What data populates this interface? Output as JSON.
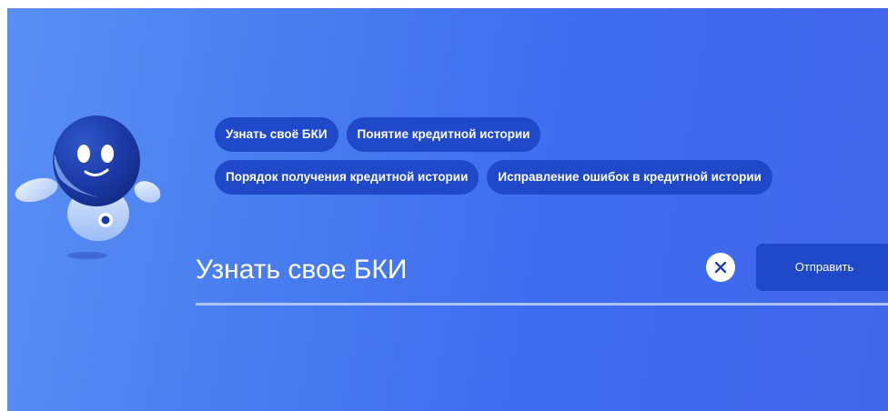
{
  "assistant": {
    "avatar_icon": "robot-assistant-icon"
  },
  "suggestions": {
    "chips": [
      "Узнать своё БКИ",
      "Понятие кредитной истории",
      "Порядок получения кредитной истории",
      "Исправление ошибок в кредитной истории"
    ]
  },
  "input": {
    "value": "Узнать свое БКИ",
    "clear_icon": "close-icon"
  },
  "send_button": {
    "label": "Отправить"
  },
  "colors": {
    "background_start": "#5a8ff5",
    "background_end": "#4266ea",
    "chip_bg": "#1f49c9",
    "button_bg": "#1f49c9",
    "text": "#ffffff"
  }
}
